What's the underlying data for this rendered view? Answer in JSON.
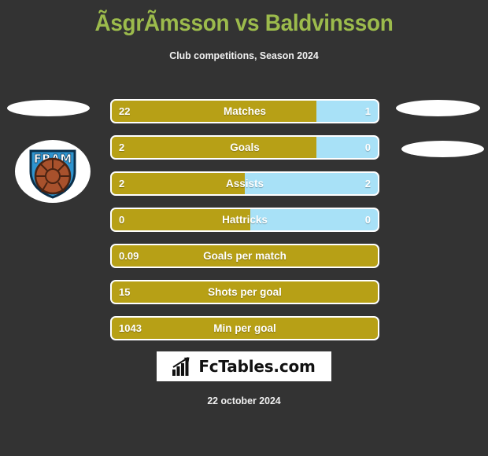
{
  "header": {
    "title": "ÃsgrÃmsson vs Baldvinsson",
    "subtitle": "Club competitions, Season 2024",
    "title_color": "#9cbb4c"
  },
  "crest": {
    "name": "fram-club-crest",
    "text": "FRAM",
    "shield_color": "#2f94cf",
    "shield_outline": "#0b2f4a",
    "ball_color": "#a8512c"
  },
  "colors": {
    "background": "#333333",
    "home_bar": "#b7a016",
    "away_bar": "#a8e1f7",
    "bar_border": "#ffffff",
    "text": "#ffffff"
  },
  "stats": [
    {
      "label": "Matches",
      "home": "22",
      "away": "1",
      "home_pct": 77,
      "has_away": true
    },
    {
      "label": "Goals",
      "home": "2",
      "away": "0",
      "home_pct": 77,
      "has_away": true
    },
    {
      "label": "Assists",
      "home": "2",
      "away": "2",
      "home_pct": 50,
      "has_away": true
    },
    {
      "label": "Hattricks",
      "home": "0",
      "away": "0",
      "home_pct": 52,
      "has_away": true
    },
    {
      "label": "Goals per match",
      "home": "0.09",
      "away": "",
      "home_pct": 100,
      "has_away": false
    },
    {
      "label": "Shots per goal",
      "home": "15",
      "away": "",
      "home_pct": 100,
      "has_away": false
    },
    {
      "label": "Min per goal",
      "home": "1043",
      "away": "",
      "home_pct": 100,
      "has_away": false
    }
  ],
  "footer": {
    "logo_text": "FcTables.com",
    "logo_icon": "bar-chart-arrow-icon",
    "date": "22 october 2024"
  },
  "chart_data": {
    "type": "bar",
    "title": "ÃsgrÃmsson vs Baldvinsson",
    "subtitle": "Club competitions, Season 2024",
    "categories": [
      "Matches",
      "Goals",
      "Assists",
      "Hattricks",
      "Goals per match",
      "Shots per goal",
      "Min per goal"
    ],
    "series": [
      {
        "name": "ÃsgrÃmsson",
        "values": [
          22,
          2,
          2,
          0,
          0.09,
          15,
          1043
        ]
      },
      {
        "name": "Baldvinsson",
        "values": [
          1,
          0,
          2,
          0,
          null,
          null,
          null
        ]
      }
    ],
    "xlabel": "",
    "ylabel": "",
    "legend": "none",
    "grid": false
  }
}
